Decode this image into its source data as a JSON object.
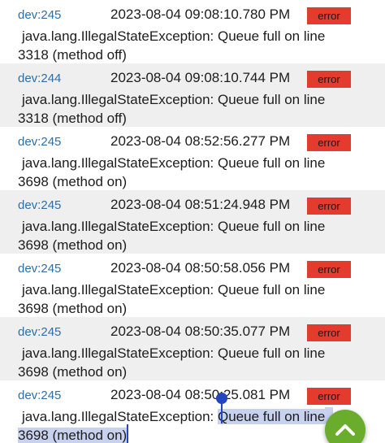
{
  "logs": [
    {
      "device": "dev:245",
      "timestamp": "2023-08-04 09:08:10.780 PM",
      "level": "error",
      "line1": "java.lang.IllegalStateException: Queue full on line",
      "line2": "3318 (method off)"
    },
    {
      "device": "dev:244",
      "timestamp": "2023-08-04 09:08:10.744 PM",
      "level": "error",
      "line1": "java.lang.IllegalStateException: Queue full on line",
      "line2": "3318 (method off)"
    },
    {
      "device": "dev:245",
      "timestamp": "2023-08-04 08:52:56.277 PM",
      "level": "error",
      "line1": "java.lang.IllegalStateException: Queue full on line",
      "line2": "3698 (method on)"
    },
    {
      "device": "dev:245",
      "timestamp": "2023-08-04 08:51:24.948 PM",
      "level": "error",
      "line1": "java.lang.IllegalStateException: Queue full on line",
      "line2": "3698 (method on)"
    },
    {
      "device": "dev:245",
      "timestamp": "2023-08-04 08:50:58.056 PM",
      "level": "error",
      "line1": "java.lang.IllegalStateException: Queue full on line",
      "line2": "3698 (method on)"
    },
    {
      "device": "dev:245",
      "timestamp": "2023-08-04 08:50:35.077 PM",
      "level": "error",
      "line1": "java.lang.IllegalStateException: Queue full on line",
      "line2": "3698 (method on)"
    },
    {
      "device": "dev:245",
      "timestamp": "2023-08-04 08:50:25.081 PM",
      "level": "error",
      "line1_prefix": "java.lang.IllegalStateException: ",
      "line1_selected": "Queue full on line",
      "line2": "3698 (method on)"
    }
  ],
  "colors": {
    "device_link": "#2f6ea6",
    "error_badge": "#e33b2e",
    "selection": "#c8d2ee",
    "selection_handle": "#2546c0",
    "fab": "#6aad2c"
  },
  "fab_icon": "chevron-up-icon"
}
